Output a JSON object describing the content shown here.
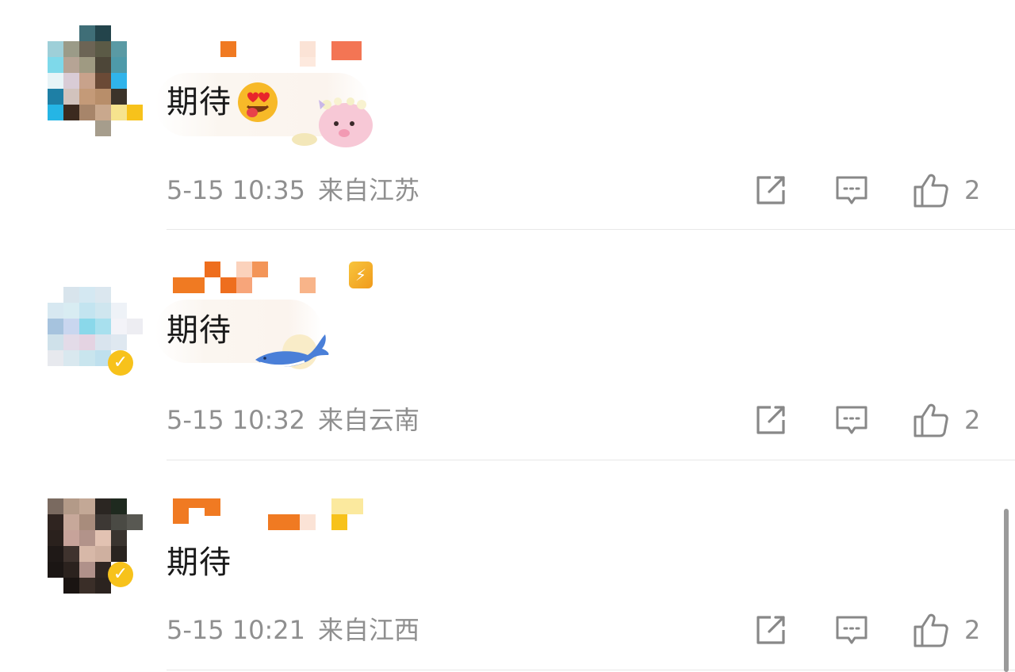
{
  "comments": [
    {
      "text": "期待",
      "emoji": "heart-eyes-tongue-face",
      "timestamp": "5-15 10:35",
      "location": "来自江苏",
      "like_count": "2",
      "sticker": "pink-piglet-with-flowers"
    },
    {
      "text": "期待",
      "timestamp": "5-15 10:32",
      "location": "来自云南",
      "like_count": "2",
      "sticker": "blue-whale"
    },
    {
      "text": "期待",
      "timestamp": "5-15 10:21",
      "location": "来自江西",
      "like_count": "2"
    }
  ],
  "actions": {
    "share_icon": "share-icon",
    "reply_icon": "reply-icon",
    "like_icon": "thumbs-up-icon"
  },
  "colors": {
    "username_orange": "#f07a22",
    "meta_gray": "#8f8f8f",
    "verified_yellow": "#f7c21b"
  }
}
